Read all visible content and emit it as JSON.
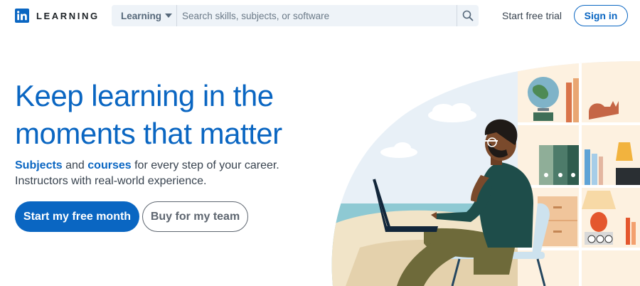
{
  "header": {
    "logo_mark": "in",
    "logo_text": "LEARNING",
    "search": {
      "category_label": "Learning",
      "placeholder": "Search skills, subjects, or software",
      "value": ""
    },
    "trial_link": "Start free trial",
    "signin_label": "Sign in"
  },
  "hero": {
    "headline_line1": "Keep learning in the",
    "headline_line2": "moments that matter",
    "sub_link1": "Subjects",
    "sub_and": " and ",
    "sub_link2": "courses",
    "sub_rest": " for every step of your career. Instructors with real-world experience.",
    "primary_cta": "Start my free month",
    "secondary_cta": "Buy for my team"
  },
  "colors": {
    "brand": "#0a66c2",
    "text": "#38434f",
    "search_bg": "#eef3f8"
  },
  "icons": {
    "logo": "linkedin-logo-icon",
    "search": "search-icon",
    "category_caret": "caret-down-icon"
  }
}
